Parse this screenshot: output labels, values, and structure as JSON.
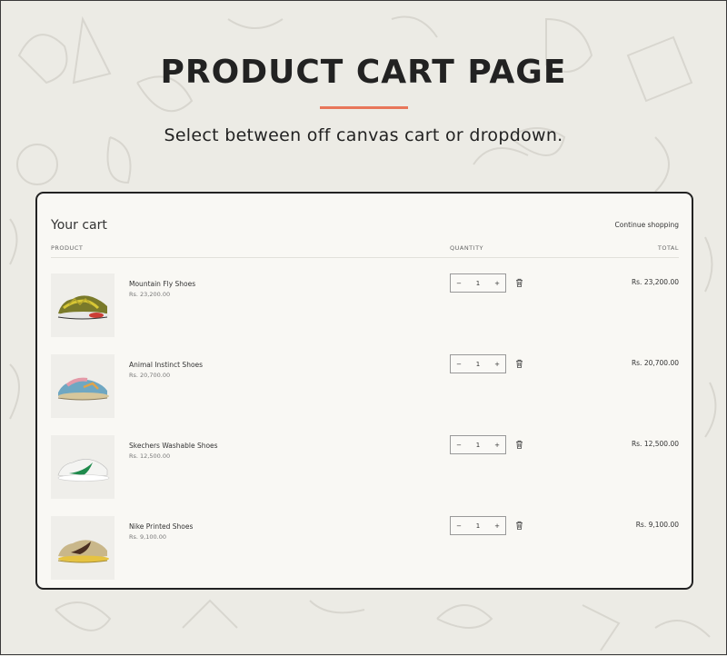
{
  "hero": {
    "title": "PRODUCT CART PAGE",
    "subtitle": "Select between off canvas cart or dropdown.",
    "accent_color": "#e8765a"
  },
  "cart": {
    "title": "Your cart",
    "continue_label": "Continue shopping",
    "columns": {
      "product": "PRODUCT",
      "quantity": "QUANTITY",
      "total": "TOTAL"
    },
    "qty_minus": "−",
    "qty_plus": "+",
    "items": [
      {
        "name": "Mountain Fly Shoes",
        "price": "Rs. 23,200.00",
        "quantity": "1",
        "total": "Rs. 23,200.00",
        "image": "olive-yellow-sneaker"
      },
      {
        "name": "Animal Instinct Shoes",
        "price": "Rs. 20,700.00",
        "quantity": "1",
        "total": "Rs. 20,700.00",
        "image": "blue-pink-sneaker"
      },
      {
        "name": "Skechers Washable Shoes",
        "price": "Rs. 12,500.00",
        "quantity": "1",
        "total": "Rs. 12,500.00",
        "image": "white-green-sneaker"
      },
      {
        "name": "Nike Printed Shoes",
        "price": "Rs. 9,100.00",
        "quantity": "1",
        "total": "Rs. 9,100.00",
        "image": "tan-yellow-sneaker"
      }
    ]
  }
}
